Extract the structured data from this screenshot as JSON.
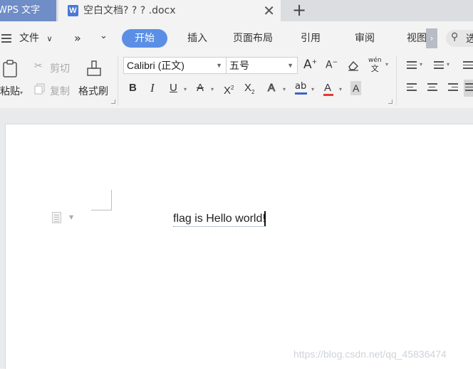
{
  "tabs": {
    "app_label": "WPS 文字",
    "doc_title": "空白文档? ? ? .docx",
    "doc_icon_letter": "W",
    "close_glyph": "✕",
    "new_tab_glyph": "+"
  },
  "menu": {
    "file_label": "文件",
    "more_glyph": "»",
    "dropdown_glyph": "⌄",
    "items": [
      "开始",
      "插入",
      "页面布局",
      "引用",
      "审阅",
      "视图"
    ],
    "scroll_glyph": "›",
    "search_text": "选"
  },
  "ribbon": {
    "paste_label": "粘贴",
    "cut_label": "剪切",
    "copy_label": "复制",
    "format_painter_label": "格式刷",
    "font_name": "Calibri (正文)",
    "font_size": "五号",
    "grow_font": "A",
    "shrink_font": "A",
    "phonetic_glyph": "wén",
    "bold": "B",
    "italic": "I",
    "underline": "U",
    "strike": "A",
    "superscript": "X",
    "subscript": "X",
    "text_effect": "A",
    "highlight": "ab",
    "font_color": "A",
    "char_shading": "A"
  },
  "document": {
    "text": "flag is Hello world!"
  },
  "watermark": "https://blog.csdn.net/qq_45836474",
  "colors": {
    "accent": "#5b8fe6",
    "app_tab": "#6f8dc7",
    "highlight_bar": "#3a63c8",
    "font_color_bar": "#e53935"
  }
}
